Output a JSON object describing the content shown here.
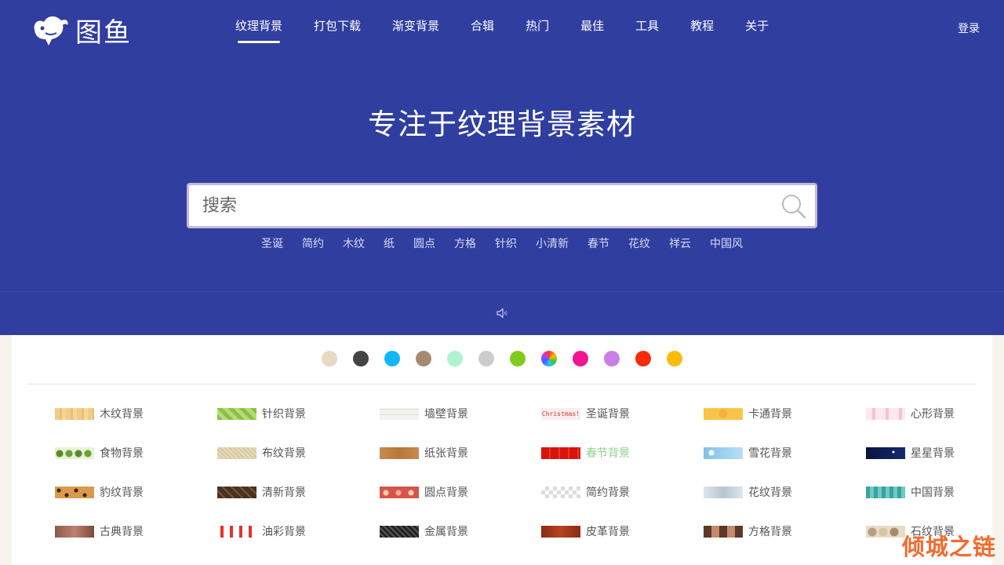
{
  "logo": {
    "text": "图鱼"
  },
  "nav": {
    "items": [
      {
        "label": "纹理背景",
        "active": true
      },
      {
        "label": "打包下载"
      },
      {
        "label": "渐变背景"
      },
      {
        "label": "合辑"
      },
      {
        "label": "热门"
      },
      {
        "label": "最佳"
      },
      {
        "label": "工具"
      },
      {
        "label": "教程"
      },
      {
        "label": "关于"
      }
    ],
    "login": "登录"
  },
  "hero": {
    "title": "专注于纹理背景素材"
  },
  "search": {
    "placeholder": "搜索",
    "value": ""
  },
  "tags": [
    "圣诞",
    "简约",
    "木纹",
    "纸",
    "圆点",
    "方格",
    "针织",
    "小清新",
    "春节",
    "花纹",
    "祥云",
    "中国风"
  ],
  "colors": [
    "#e8d9c4",
    "#444444",
    "#12b8f5",
    "#a58a72",
    "#aef3cf",
    "#cccccc",
    "#7ecb1e",
    "rainbow",
    "#f2168e",
    "#c97ee8",
    "#fb2a0c",
    "#fbbb0a"
  ],
  "categories": [
    [
      {
        "label": "木纹背景",
        "thumb": "wood"
      },
      {
        "label": "针织背景",
        "thumb": "knit"
      },
      {
        "label": "墙壁背景",
        "thumb": "wall"
      },
      {
        "label": "圣诞背景",
        "thumb": "christmas",
        "thumb_text": "Christmas!"
      },
      {
        "label": "卡通背景",
        "thumb": "cartoon"
      },
      {
        "label": "心形背景",
        "thumb": "heart"
      }
    ],
    [
      {
        "label": "食物背景",
        "thumb": "food"
      },
      {
        "label": "布纹背景",
        "thumb": "cloth"
      },
      {
        "label": "纸张背景",
        "thumb": "paper"
      },
      {
        "label": "春节背景",
        "thumb": "spring"
      },
      {
        "label": "雪花背景",
        "thumb": "snow"
      },
      {
        "label": "星星背景",
        "thumb": "star"
      }
    ],
    [
      {
        "label": "豹纹背景",
        "thumb": "leopard"
      },
      {
        "label": "清新背景",
        "thumb": "fresh"
      },
      {
        "label": "圆点背景",
        "thumb": "dots"
      },
      {
        "label": "简约背景",
        "thumb": "simple"
      },
      {
        "label": "花纹背景",
        "thumb": "floral"
      },
      {
        "label": "中国背景",
        "thumb": "china"
      }
    ],
    [
      {
        "label": "古典背景",
        "thumb": "classic"
      },
      {
        "label": "油彩背景",
        "thumb": "oil"
      },
      {
        "label": "金属背景",
        "thumb": "metal"
      },
      {
        "label": "皮革背景",
        "thumb": "leather"
      },
      {
        "label": "方格背景",
        "thumb": "grid"
      },
      {
        "label": "石纹背景",
        "thumb": "stone"
      }
    ]
  ],
  "watermark": "倾城之链"
}
